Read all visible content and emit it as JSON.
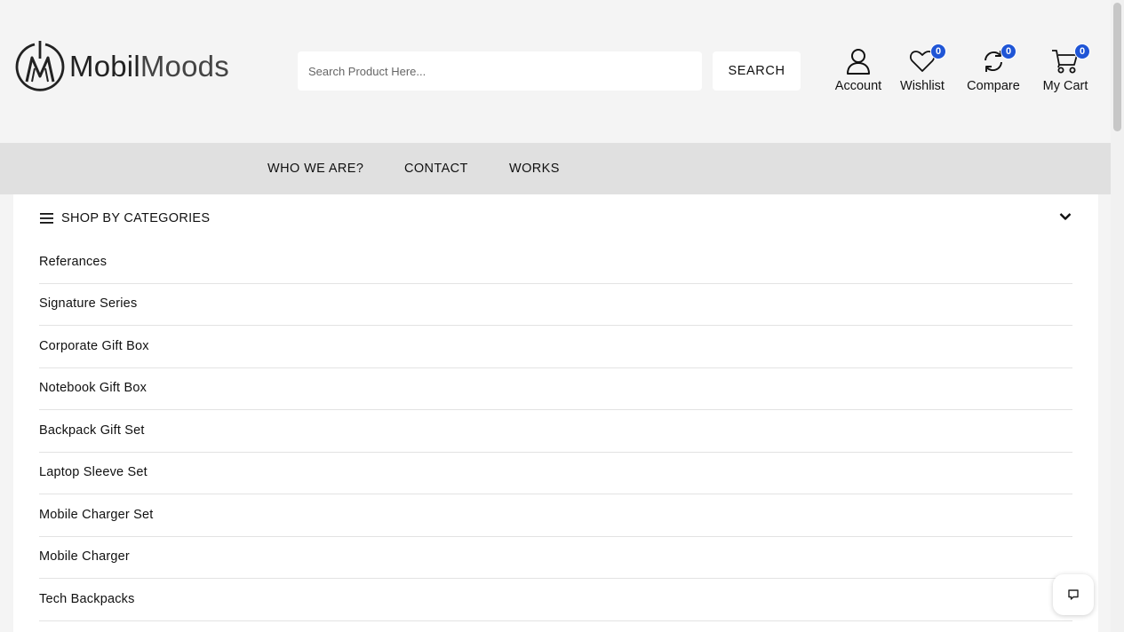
{
  "header": {
    "logo": {
      "text_bold": "Mobil",
      "text_light": "Moods"
    },
    "search": {
      "placeholder": "Search Product Here...",
      "button_label": "SEARCH"
    },
    "actions": {
      "account": {
        "label": "Account",
        "icon": "user-icon"
      },
      "wishlist": {
        "label": "Wishlist",
        "count": "0",
        "icon": "heart-icon"
      },
      "compare": {
        "label": "Compare",
        "count": "0",
        "icon": "refresh-icon"
      },
      "cart": {
        "label": "My Cart",
        "count": "0",
        "icon": "cart-icon"
      }
    },
    "badge_color": "#1f55d6"
  },
  "nav": {
    "items": [
      {
        "label": "WHO WE ARE?"
      },
      {
        "label": "CONTACT"
      },
      {
        "label": "WORKS"
      }
    ]
  },
  "categories": {
    "title": "SHOP BY CATEGORIES",
    "items": [
      {
        "label": "Referances"
      },
      {
        "label": "Signature Series"
      },
      {
        "label": "Corporate Gift Box"
      },
      {
        "label": "Notebook Gift Box"
      },
      {
        "label": "Backpack Gift Set"
      },
      {
        "label": "Laptop Sleeve Set"
      },
      {
        "label": "Mobile Charger Set"
      },
      {
        "label": "Mobile Charger"
      },
      {
        "label": "Tech Backpacks"
      }
    ]
  },
  "chat": {
    "icon": "chat-icon"
  }
}
